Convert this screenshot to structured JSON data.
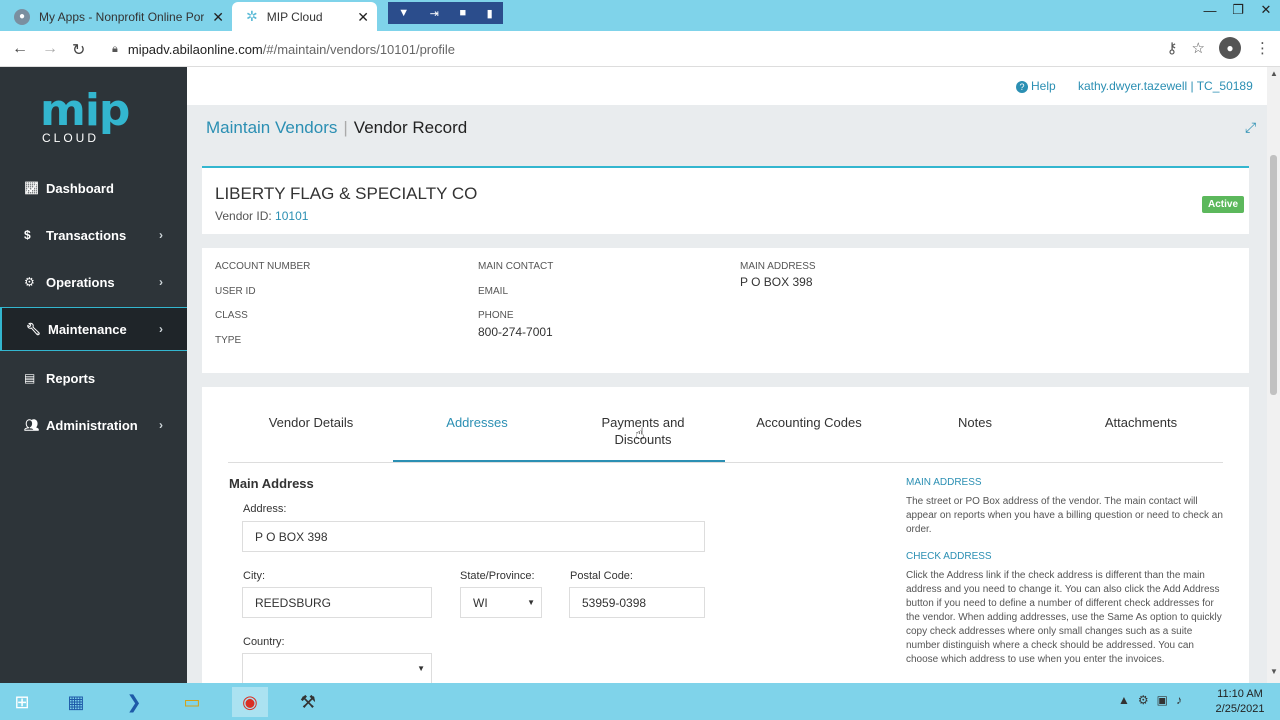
{
  "browser": {
    "tabs": [
      {
        "title": "My Apps - Nonprofit Online Port",
        "close": "✕"
      },
      {
        "title": "MIP Cloud",
        "close": "✕"
      }
    ],
    "url_domain": "mipadv.abilaonline.com",
    "url_path": "/#/maintain/vendors/10101/profile"
  },
  "sidebar": {
    "logo_main": "mip",
    "logo_sub": "CLOUD",
    "items": [
      {
        "label": "Dashboard",
        "icon": "chart-icon"
      },
      {
        "label": "Transactions",
        "icon": "dollar-icon"
      },
      {
        "label": "Operations",
        "icon": "cogs-icon"
      },
      {
        "label": "Maintenance",
        "icon": "wrench-icon"
      },
      {
        "label": "Reports",
        "icon": "document-icon"
      },
      {
        "label": "Administration",
        "icon": "users-icon"
      }
    ]
  },
  "header": {
    "help": "Help",
    "user": "kathy.dwyer.tazewell | TC_50189"
  },
  "page": {
    "breadcrumb": "Maintain Vendors",
    "separator": "|",
    "title": "Vendor Record"
  },
  "vendor": {
    "name": "LIBERTY FLAG & SPECIALTY CO",
    "id_label": "Vendor ID:",
    "id": "10101",
    "status": "Active"
  },
  "info": {
    "account_number_label": "ACCOUNT NUMBER",
    "user_id_label": "USER ID",
    "class_label": "CLASS",
    "type_label": "TYPE",
    "main_contact_label": "MAIN CONTACT",
    "email_label": "EMAIL",
    "phone_label": "PHONE",
    "phone": "800-274-7001",
    "main_address_label": "MAIN ADDRESS",
    "main_address": "P O BOX 398"
  },
  "tabs": {
    "vendor_details": "Vendor Details",
    "addresses": "Addresses",
    "payments_1": "Payments and",
    "payments_2": "Discounts",
    "accounting_codes": "Accounting Codes",
    "notes": "Notes",
    "attachments": "Attachments"
  },
  "form": {
    "section": "Main Address",
    "address_label": "Address:",
    "address": "P O BOX 398",
    "city_label": "City:",
    "city": "REEDSBURG",
    "state_label": "State/Province:",
    "state": "WI",
    "postal_label": "Postal Code:",
    "postal": "53959-0398",
    "country_label": "Country:",
    "country": ""
  },
  "help_panel": {
    "main_title": "MAIN ADDRESS",
    "main_body": "The street or PO Box address of the vendor. The main contact will appear on reports when you have a billing question or need to check an order.",
    "check_title": "CHECK ADDRESS",
    "check_body": "Click the Address link if the check address is different than the main address and you need to change it. You can also click the Add Address button if you need to define a number of different check addresses for the vendor. When adding addresses, use the Same As option to quickly copy check addresses where only small changes such as a suite number distinguish where a check should be addressed. You can choose which address to use when you enter the invoices."
  },
  "taskbar": {
    "time": "11:10 AM",
    "date": "2/25/2021"
  }
}
